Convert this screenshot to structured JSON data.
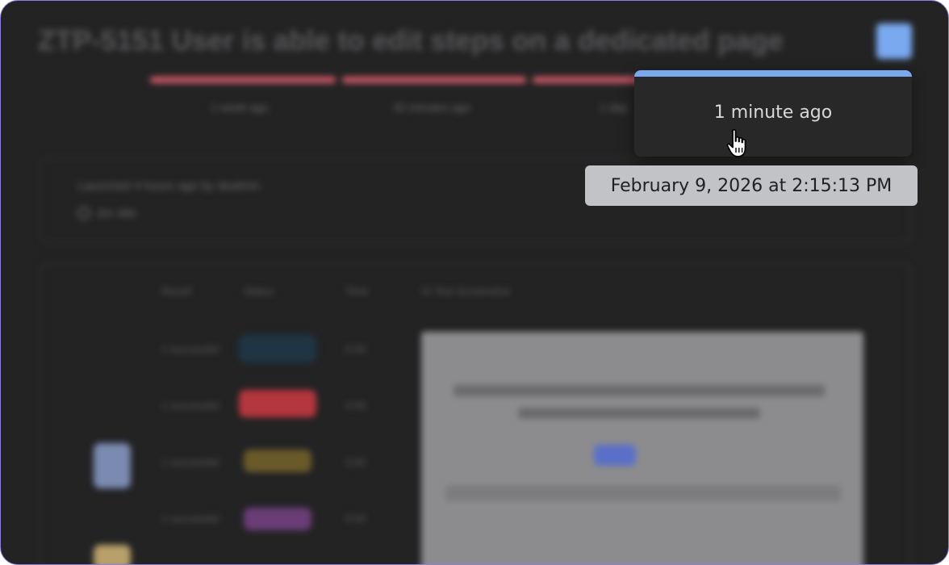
{
  "page": {
    "title": "ZTP-5151 User is able to edit steps on a dedicated page"
  },
  "timeline": {
    "labels": [
      "1 week ago",
      "30 minutes ago",
      "1 day"
    ]
  },
  "info": {
    "launched": "Launched 4 hours ago by dealmin",
    "duration": "2m 48s"
  },
  "results": {
    "columns": [
      "Result",
      "Status",
      "Time",
      "UI Test Screenshot"
    ],
    "rows": [
      {
        "name": "1 successful",
        "time": "0:00"
      },
      {
        "name": "1 successful",
        "time": "0:00"
      },
      {
        "name": "1 successful",
        "time": "0:00"
      },
      {
        "name": "1 successful",
        "time": "0:00"
      }
    ]
  },
  "popover": {
    "text": "1 minute ago"
  },
  "tooltip": {
    "text": "February 9, 2026 at 2:15:13 PM"
  },
  "colors": {
    "accent": "#7aa9f0",
    "frame_border": "#8b7fe0",
    "timeline_segment": "#d05a66",
    "tooltip_bg": "#c1c3c6",
    "background": "#232324"
  },
  "icons": {
    "cursor": "hand-pointer-icon",
    "duration": "clock-icon"
  }
}
